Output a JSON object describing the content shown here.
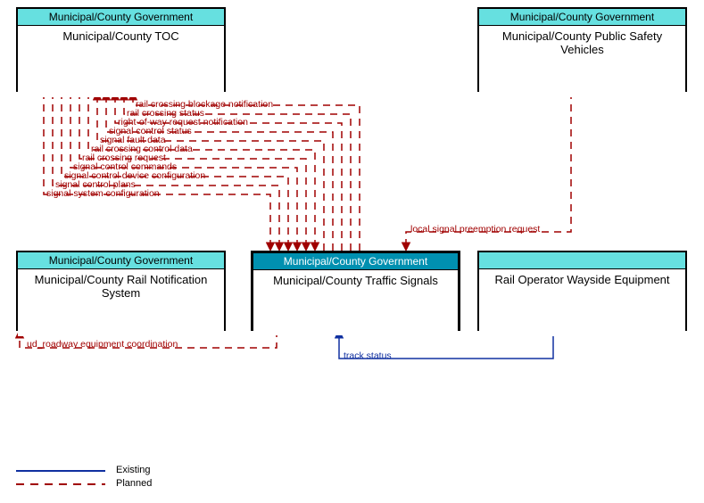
{
  "entities": {
    "toc": {
      "owner": "Municipal/County Government",
      "name": "Municipal/County TOC"
    },
    "psv": {
      "owner": "Municipal/County Government",
      "name": "Municipal/County Public Safety Vehicles"
    },
    "rail": {
      "owner": "Municipal/County Government",
      "name": "Municipal/County Rail Notification System"
    },
    "sig": {
      "owner": "Municipal/County Government",
      "name": "Municipal/County Traffic Signals"
    },
    "rowe": {
      "owner": "",
      "name": "Rail Operator Wayside Equipment"
    }
  },
  "flows": {
    "f1": "rail crossing blockage notification",
    "f2": "rail crossing status",
    "f3": "right-of-way request notification",
    "f4": "signal control status",
    "f5": "signal fault data",
    "f6": "rail crossing control data",
    "f7": "rail crossing request",
    "f8": "signal control commands",
    "f9": "signal control device configuration",
    "f10": "signal control plans",
    "f11": "signal system configuration",
    "f12": "local signal preemption request",
    "f13": "ud_roadway equipment coordination",
    "f14": "track status"
  },
  "legend": {
    "existing": "Existing",
    "planned": "Planned"
  },
  "colors": {
    "hdr_normal": "#66e0e0",
    "hdr_focus": "#0090b0",
    "planned": "#a00000",
    "existing": "#1030a0"
  }
}
